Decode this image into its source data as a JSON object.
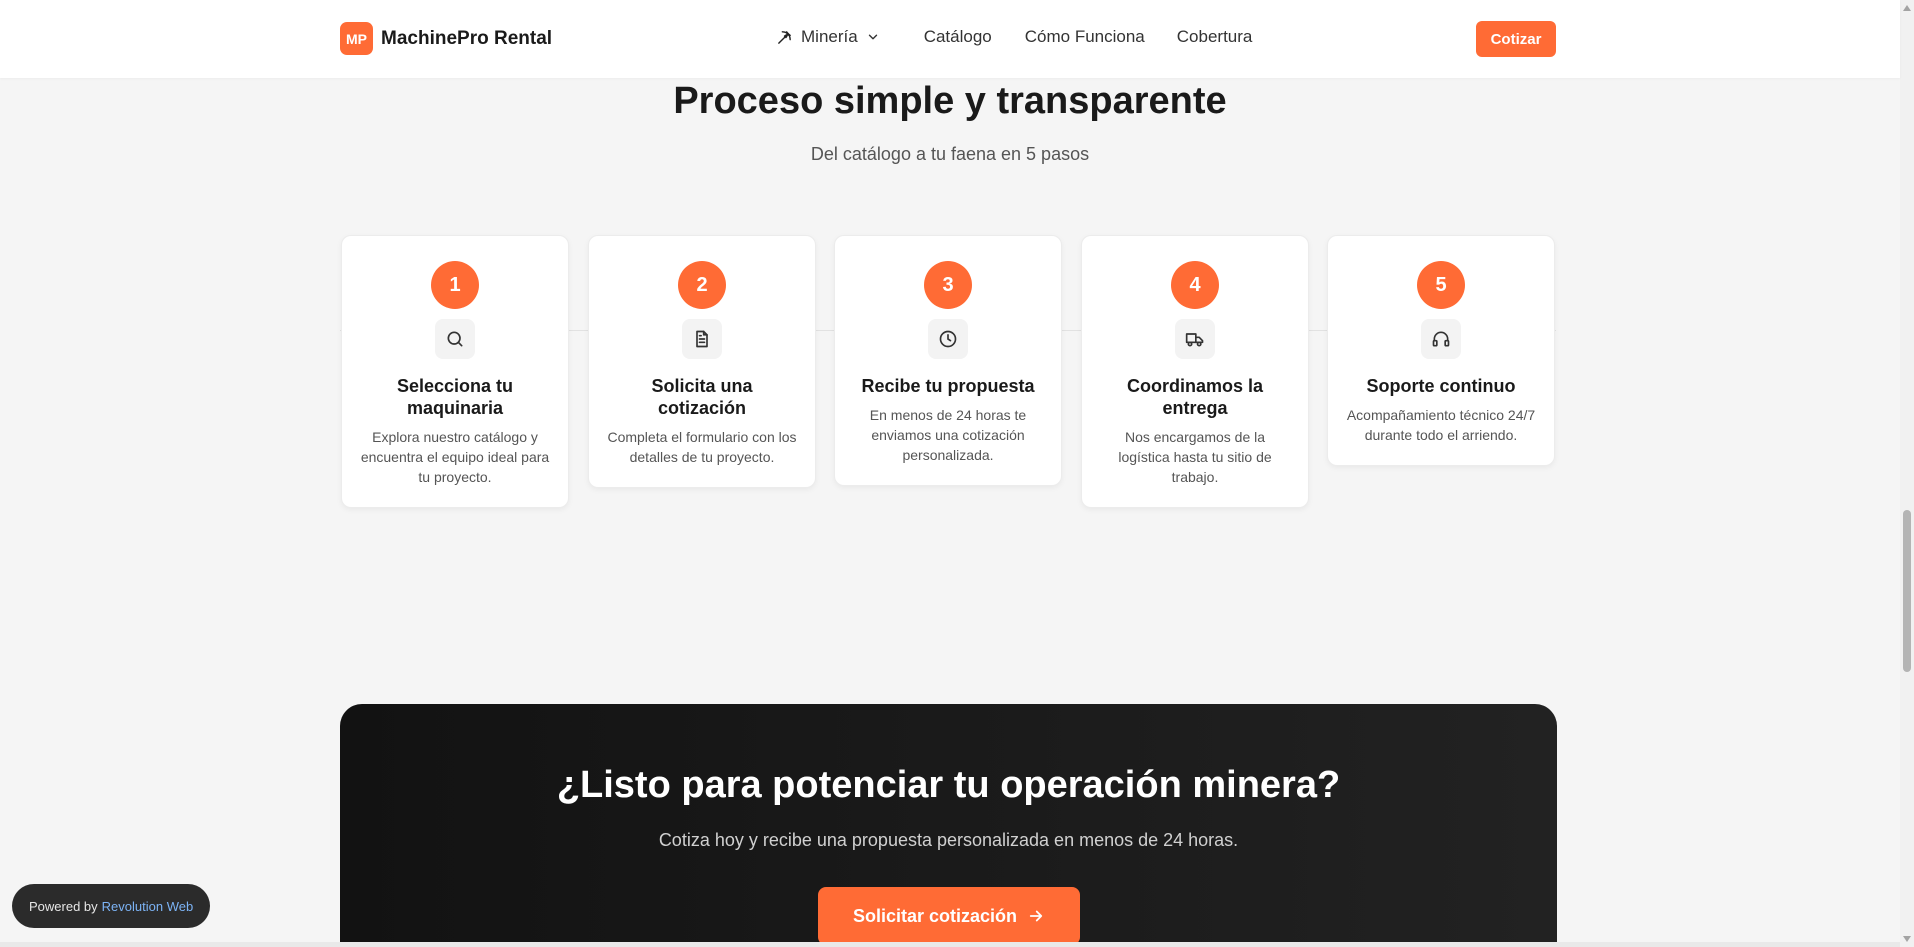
{
  "brand": {
    "badge": "MP",
    "name": "MachinePro Rental"
  },
  "nav": {
    "mineria": "Minería",
    "catalogo": "Catálogo",
    "como_funciona": "Cómo Funciona",
    "cobertura": "Cobertura"
  },
  "header_cta": "Cotizar",
  "section": {
    "title": "Proceso simple y transparente",
    "subtitle": "Del catálogo a tu faena en 5 pasos"
  },
  "steps": [
    {
      "number": "1",
      "icon": "search-icon",
      "title": "Selecciona tu maquinaria",
      "desc": "Explora nuestro catálogo y encuentra el equipo ideal para tu proyecto."
    },
    {
      "number": "2",
      "icon": "document-icon",
      "title": "Solicita una cotización",
      "desc": "Completa el formulario con los detalles de tu proyecto."
    },
    {
      "number": "3",
      "icon": "clock-icon",
      "title": "Recibe tu propuesta",
      "desc": "En menos de 24 horas te enviamos una cotización personalizada."
    },
    {
      "number": "4",
      "icon": "truck-icon",
      "title": "Coordinamos la entrega",
      "desc": "Nos encargamos de la logística hasta tu sitio de trabajo."
    },
    {
      "number": "5",
      "icon": "headphones-icon",
      "title": "Soporte continuo",
      "desc": "Acompañamiento técnico 24/7 durante todo el arriendo."
    }
  ],
  "cta": {
    "title": "¿Listo para potenciar tu operación minera?",
    "subtitle": "Cotiza hoy y recibe una propuesta personalizada en menos de 24 horas.",
    "button": "Solicitar cotización"
  },
  "powered": {
    "prefix": "Powered by",
    "brand": "Revolution Web"
  },
  "colors": {
    "accent": "#ff6b35",
    "dark": "#1a1a1a",
    "background": "#f5f5f5"
  }
}
